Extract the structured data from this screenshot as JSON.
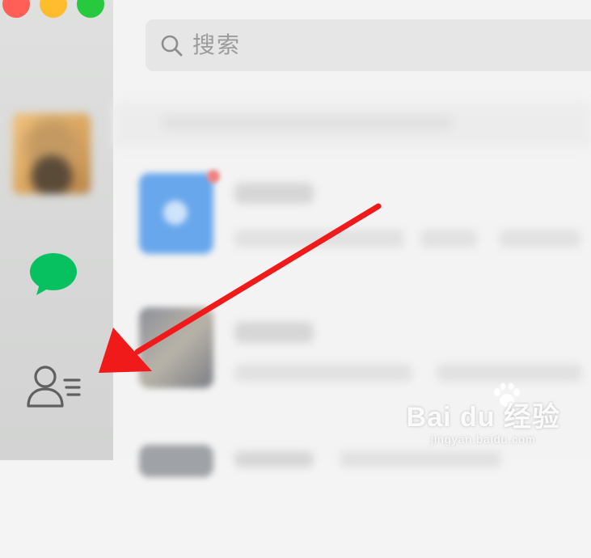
{
  "window": {
    "controls": [
      "close",
      "minimize",
      "zoom"
    ]
  },
  "sidebar": {
    "items": [
      {
        "name": "avatar"
      },
      {
        "name": "chats",
        "icon": "chat-bubble-icon",
        "color": "#07c160"
      },
      {
        "name": "contacts",
        "icon": "contacts-icon"
      }
    ]
  },
  "search": {
    "placeholder": "搜索"
  },
  "annotation": {
    "type": "arrow",
    "color": "#f01a1a",
    "points_to": "contacts-icon"
  },
  "watermark": {
    "brand": "Bai du 经验",
    "url": "jingyan.baidu.com"
  }
}
